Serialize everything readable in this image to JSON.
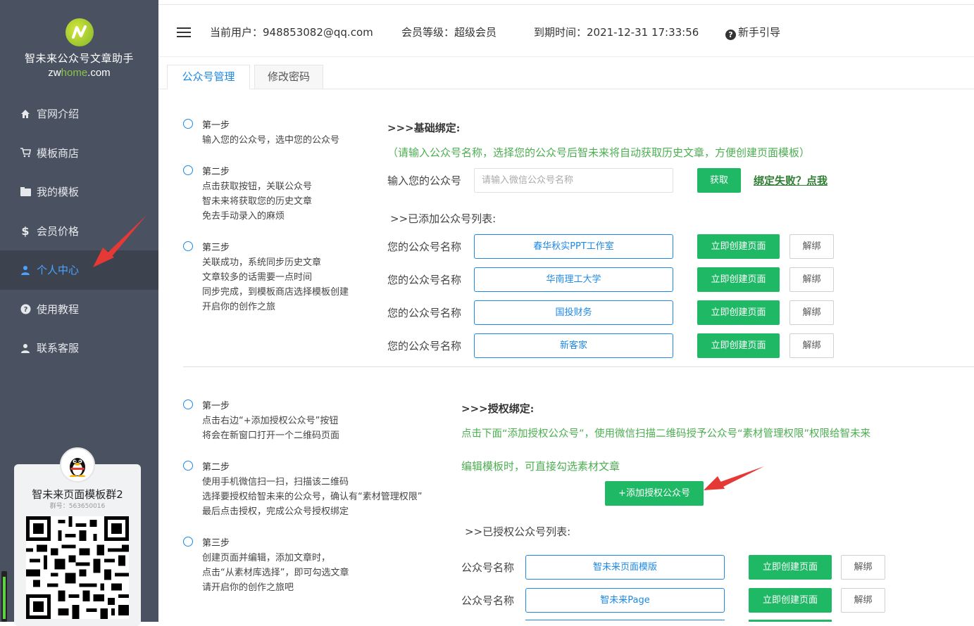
{
  "brand": {
    "title": "智未来公众号文章助手",
    "url_prefix": "zw",
    "url_highlight": "home",
    "url_suffix": ".com"
  },
  "sidebar": {
    "items": [
      {
        "label": "官网介绍",
        "icon": "home-icon"
      },
      {
        "label": "模板商店",
        "icon": "cart-icon"
      },
      {
        "label": "我的模板",
        "icon": "folder-icon"
      },
      {
        "label": "会员价格",
        "icon": "dollar-icon"
      },
      {
        "label": "个人中心",
        "icon": "user-icon",
        "active": true
      },
      {
        "label": "使用教程",
        "icon": "help-icon"
      },
      {
        "label": "联系客服",
        "icon": "user-icon"
      }
    ],
    "qq_card": {
      "title": "智未来页面模板群2",
      "group_no": "群号：563650016"
    }
  },
  "topbar": {
    "current_user": "当前用户：948853082@qq.com",
    "member_level": "会员等级：超级会员",
    "expire_time": "到期时间：2021-12-31 17:33:56",
    "guide": "新手引导"
  },
  "tabs": [
    {
      "label": "公众号管理",
      "active": true
    },
    {
      "label": "修改密码",
      "active": false
    }
  ],
  "basic": {
    "steps": [
      {
        "title": "第一步",
        "lines": [
          "输入您的公众号，选中您的公众号"
        ]
      },
      {
        "title": "第二步",
        "lines": [
          "点击获取按钮，关联公众号",
          "智未来将获取您的历史文章",
          "免去手动录入的麻烦"
        ]
      },
      {
        "title": "第三步",
        "lines": [
          "关联成功，系统同步历史文章",
          "文章较多的话需要一点时间",
          "同步完成，到模板商店选择模板创建",
          "开启你的创作之旅"
        ]
      }
    ],
    "section_title": ">>>基础绑定:",
    "note": "（请输入公众号名称，选择您的公众号后智未来将自动获取历史文章，方便创建页面模板）",
    "input_label": "输入您的公众号",
    "input_placeholder": "请输入微信公众号名称",
    "fetch_button": "获取",
    "fail_link": "绑定失败？点我",
    "list_title": ">>已添加公众号列表:",
    "account_label": "您的公众号名称",
    "create_button": "立即创建页面",
    "unbind_button": "解绑",
    "accounts": [
      "春华秋实PPT工作室",
      "华南理工大学",
      "国投财务",
      "新客家"
    ]
  },
  "auth": {
    "steps": [
      {
        "title": "第一步",
        "lines": [
          "点击右边“+添加授权公众号”按钮",
          "将会在新窗口打开一个二维码页面"
        ]
      },
      {
        "title": "第二步",
        "lines": [
          "使用手机微信扫一扫，扫描该二维码",
          "选择要授权给智未来的公众号，确认有“素材管理权限”",
          "最后点击授权，完成公众号授权绑定"
        ]
      },
      {
        "title": "第三步",
        "lines": [
          "创建页面并编辑，添加文章时，",
          "点击“从素材库选择”，即可勾选文章",
          "请开启你的创作之旅吧"
        ]
      }
    ],
    "section_title": ">>>授权绑定:",
    "note_line1": "点击下面“添加授权公众号”，使用微信扫描二维码授予公众号“素材管理权限”权限给智未来",
    "note_line2": "编辑模板时，可直接勾选素材文章",
    "add_button": "+添加授权公众号",
    "list_title": ">>已授权公众号列表:",
    "account_label": "公众号名称",
    "create_button": "立即创建页面",
    "unbind_button": "解绑",
    "accounts": [
      "智未来页面模版",
      "智未来Page"
    ]
  },
  "colors": {
    "sidebar_bg": "#4a5261",
    "accent_blue": "#1e88e5",
    "green": "#1fb864",
    "arrow_red": "#e53935"
  }
}
